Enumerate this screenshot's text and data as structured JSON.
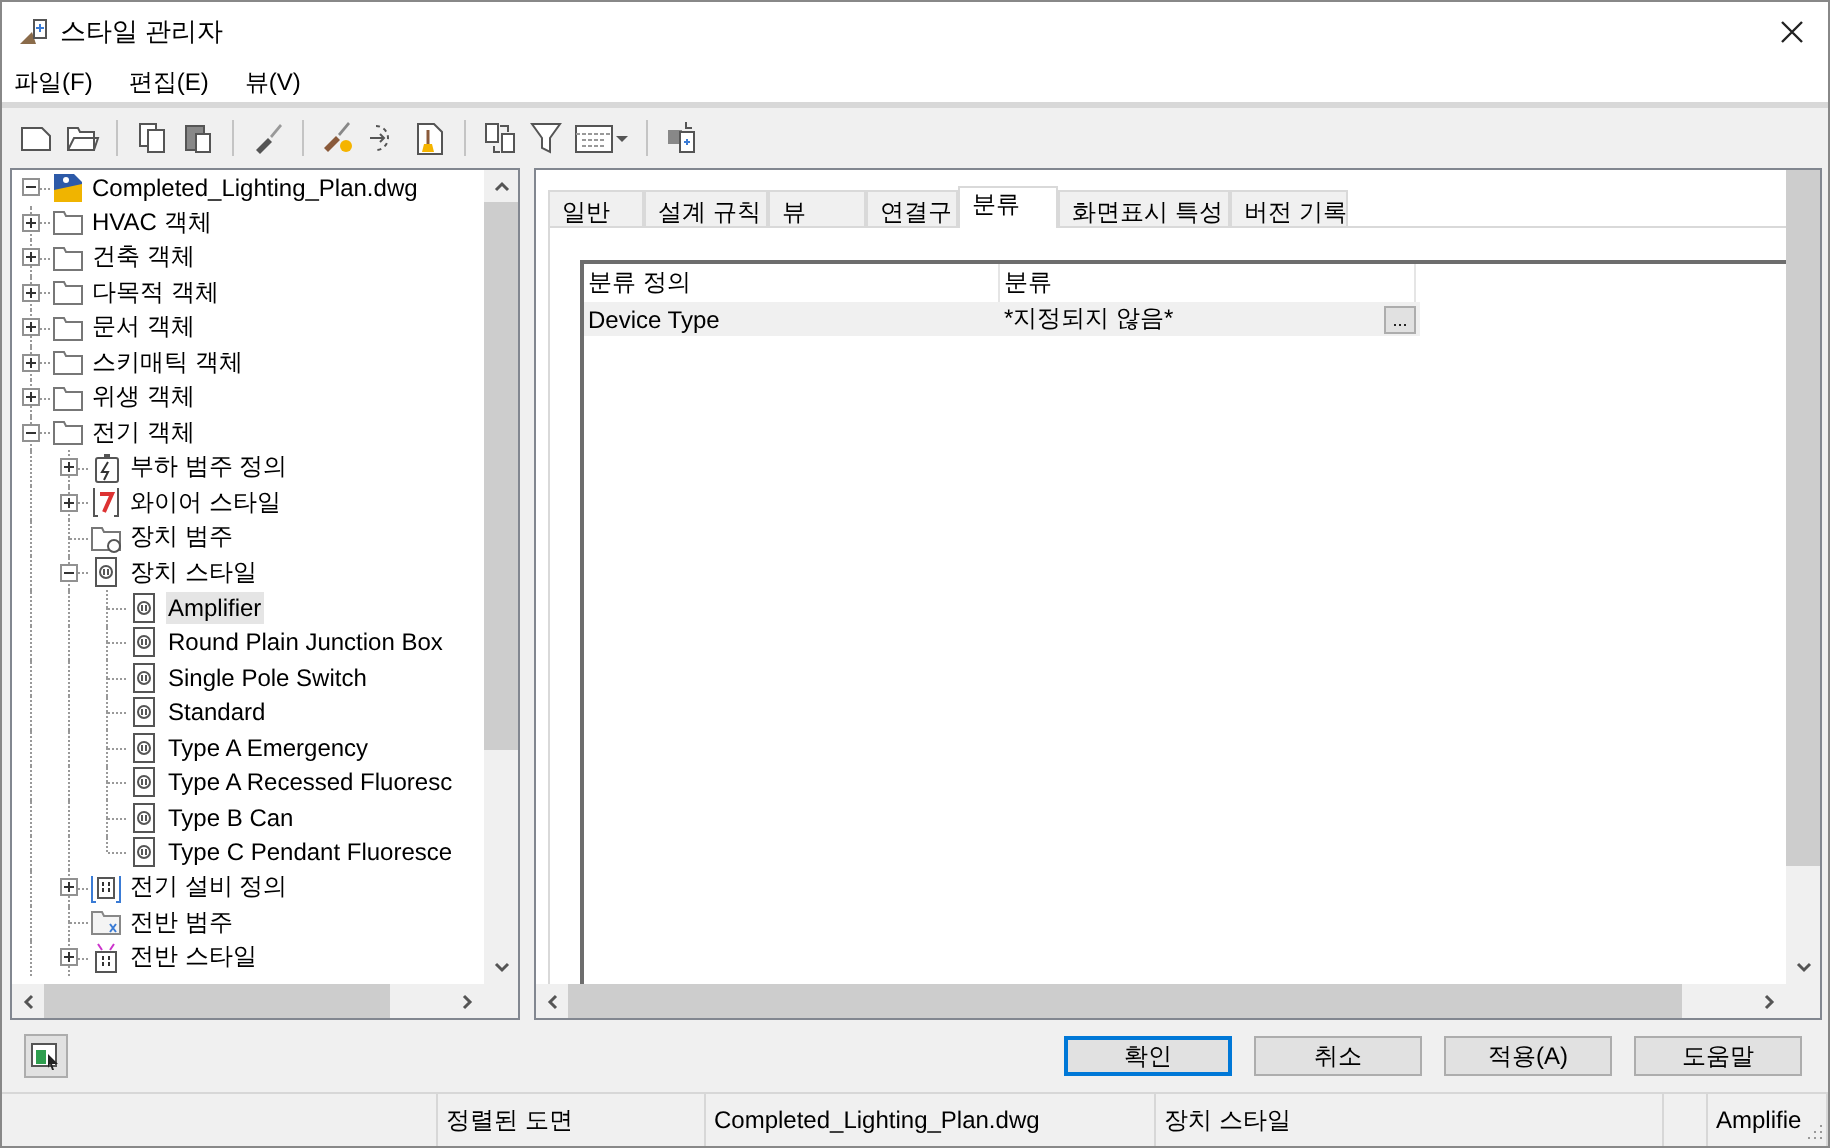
{
  "window": {
    "title": "스타일 관리자"
  },
  "menu": [
    "파일(F)",
    "편집(E)",
    "뷰(V)"
  ],
  "tree": {
    "label": "Completed_Lighting_Plan.dwg",
    "kind": "drawing",
    "expanded": true,
    "selected": false,
    "children": [
      {
        "label": "HVAC 객체",
        "kind": "folder",
        "expanded": false,
        "selected": false
      },
      {
        "label": "건축 객체",
        "kind": "folder",
        "expanded": false,
        "selected": false
      },
      {
        "label": "다목적 객체",
        "kind": "folder",
        "expanded": false,
        "selected": false
      },
      {
        "label": "문서 객체",
        "kind": "folder",
        "expanded": false,
        "selected": false
      },
      {
        "label": "스키매틱 객체",
        "kind": "folder",
        "expanded": false,
        "selected": false
      },
      {
        "label": "위생 객체",
        "kind": "folder",
        "expanded": false,
        "selected": false
      },
      {
        "label": "전기 객체",
        "kind": "folder",
        "expanded": true,
        "selected": false,
        "children": [
          {
            "label": "부하 범주 정의",
            "kind": "load",
            "expanded": false,
            "selected": false
          },
          {
            "label": "와이어 스타일",
            "kind": "wire",
            "expanded": false,
            "selected": false
          },
          {
            "label": "장치 범주",
            "kind": "category",
            "selected": false
          },
          {
            "label": "장치 스타일",
            "kind": "device",
            "expanded": true,
            "selected": false,
            "children": [
              {
                "label": "Amplifier",
                "kind": "device",
                "selected": true
              },
              {
                "label": "Round Plain Junction Box",
                "kind": "device",
                "selected": false
              },
              {
                "label": "Single Pole Switch",
                "kind": "device",
                "selected": false
              },
              {
                "label": "Standard",
                "kind": "device",
                "selected": false
              },
              {
                "label": "Type A Emergency",
                "kind": "device",
                "selected": false
              },
              {
                "label": "Type A Recessed Fluoresc",
                "kind": "device",
                "selected": false
              },
              {
                "label": "Type B Can",
                "kind": "device",
                "selected": false
              },
              {
                "label": "Type C Pendant Fluoresce",
                "kind": "device",
                "selected": false
              }
            ]
          },
          {
            "label": "전기 설비 정의",
            "kind": "equipment",
            "expanded": false,
            "selected": false
          },
          {
            "label": "전반 범주",
            "kind": "panel-category",
            "selected": false
          },
          {
            "label": "전반 스타일",
            "kind": "panel-style",
            "expanded": false,
            "selected": false
          }
        ]
      }
    ]
  },
  "tabs": [
    {
      "label": "일반",
      "selected": false
    },
    {
      "label": "설계 규칙",
      "selected": false
    },
    {
      "label": "뷰",
      "selected": false
    },
    {
      "label": "연결구",
      "selected": false
    },
    {
      "label": "분류",
      "selected": true
    },
    {
      "label": "화면표시 특성",
      "selected": false
    },
    {
      "label": "버전 기록",
      "selected": false
    }
  ],
  "grid": {
    "columns": [
      "분류 정의",
      "분류"
    ],
    "rows": [
      {
        "cells": [
          "Device Type",
          "*지정되지 않음*"
        ],
        "button": "..."
      }
    ]
  },
  "buttons": [
    {
      "label": "확인",
      "default": true
    },
    {
      "label": "취소",
      "default": false
    },
    {
      "label": "적용(A)",
      "default": false
    },
    {
      "label": "도움말",
      "default": false
    }
  ],
  "status_bar": [
    "정렬된 도면",
    "Completed_Lighting_Plan.dwg",
    "장치 스타일",
    "Amplifie"
  ]
}
